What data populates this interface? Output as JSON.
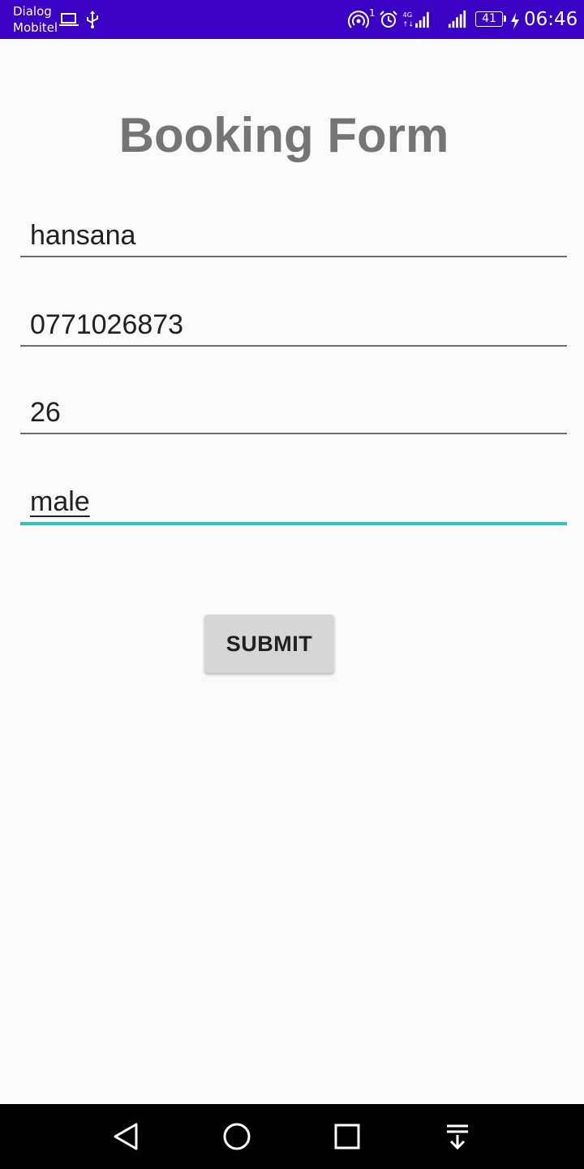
{
  "status_bar": {
    "carrier_line1": "Dialog",
    "carrier_line2": "Mobitel",
    "hotspot_count": "1",
    "network_type": "4G",
    "battery_level": "41",
    "time": "06:46",
    "background_color": "#3a00c4",
    "icons": [
      "laptop-icon",
      "usb-icon",
      "hotspot-icon",
      "alarm-icon",
      "signal-4g-icon",
      "signal-icon",
      "battery-icon",
      "charging-icon"
    ]
  },
  "form": {
    "title": "Booking Form",
    "fields": [
      {
        "value": "hansana"
      },
      {
        "value": "0771026873"
      },
      {
        "value": "26"
      },
      {
        "value": "male",
        "focused": true
      }
    ],
    "submit_label": "SUBMIT",
    "accent_color": "#2ec4c1"
  },
  "nav_bar": {
    "icons": [
      "back-icon",
      "home-icon",
      "recents-icon",
      "notification-pull-icon"
    ]
  }
}
